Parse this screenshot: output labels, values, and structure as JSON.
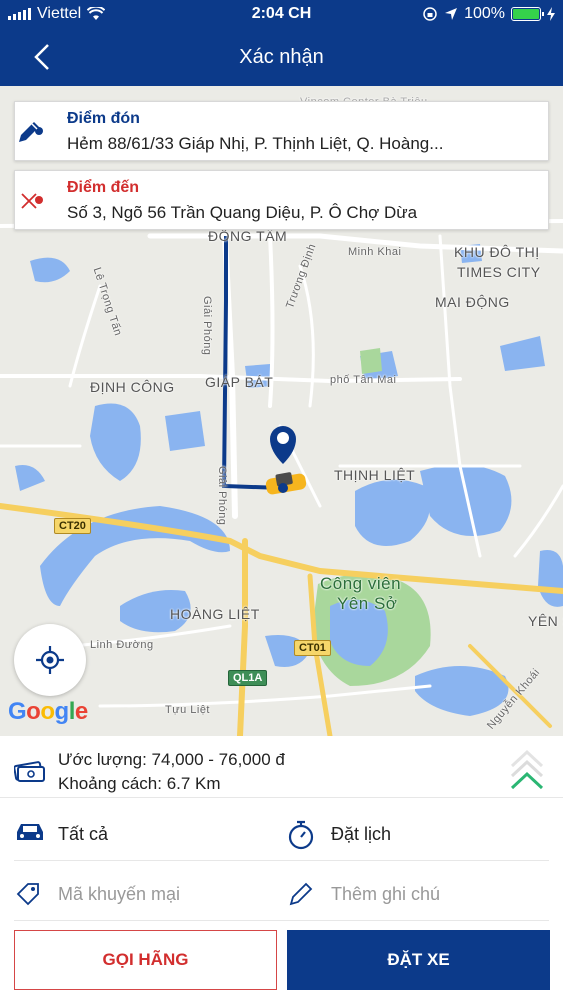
{
  "status": {
    "carrier": "Viettel",
    "time": "2:04 CH",
    "battery": "100%"
  },
  "header": {
    "title": "Xác nhận"
  },
  "pickup": {
    "label": "Điểm đón",
    "address": "Hẻm 88/61/33 Giáp Nhị, P. Thịnh Liệt, Q. Hoàng...",
    "color": "#0c3a8a"
  },
  "destination": {
    "label": "Điểm đến",
    "address": "Số 3, Ngõ 56 Trần Quang Diệu, P. Ô Chợ Dừa",
    "color": "#d22e2e"
  },
  "map": {
    "labels": {
      "vincom": "Vincom Center Bà Triệu",
      "dong_tam": "ĐỒNG TÂM",
      "minh_khai": "Minh Khai",
      "khu_do_thi": "KHU ĐÔ THỊ",
      "times_city": "TIMES CITY",
      "mai_dong": "MAI ĐỘNG",
      "le_trong_tan": "Lê Trọng Tấn",
      "giai_phong": "Giải Phóng",
      "truong_dinh": "Trương Định",
      "dinh_cong": "ĐỊNH CÔNG",
      "giap_bat": "GIÁP BÁT",
      "pho_tan_mai": "phố Tân Mai",
      "thinh_liet": "THỊNH LIỆT",
      "giai_phong2": "Giải Phóng",
      "cong_vien": "Công viên",
      "yen_so": "Yên Sở",
      "hoang_liet": "HOÀNG LIỆT",
      "yen": "YÊN S",
      "linh_duong": "Linh Đường",
      "tuu_liet": "Tựu Liệt",
      "nguyen_khoai": "Nguyễn Khoái"
    },
    "shields": {
      "ct20": "CT20",
      "ct01": "CT01",
      "ql1a": "QL1A"
    },
    "attribution": [
      "G",
      "o",
      "o",
      "g",
      "l",
      "e"
    ]
  },
  "estimate": {
    "price": "Ước lượng: 74,000 - 76,000 đ",
    "distance": "Khoảng cách: 6.7 Km"
  },
  "options": {
    "vehicle": "Tất cả",
    "schedule": "Đặt lịch",
    "promo_placeholder": "Mã khuyến mại",
    "note_placeholder": "Thêm ghi chú"
  },
  "buttons": {
    "call": "GỌI HÃNG",
    "book": "ĐẶT XE"
  },
  "colors": {
    "brand": "#0c3a8a",
    "danger": "#d22e2e",
    "accent": "#2bb673"
  }
}
